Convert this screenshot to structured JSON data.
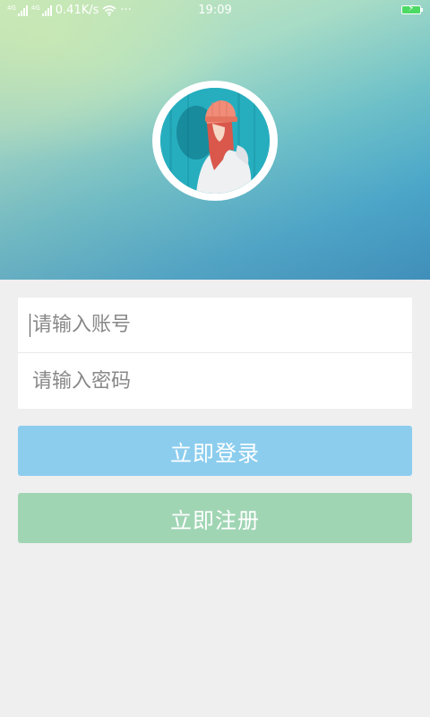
{
  "status_bar": {
    "speed": "0.41K/s",
    "more": "···",
    "time": "19:09",
    "sim1_tag": "4G",
    "sim2_tag": "4G"
  },
  "login": {
    "account_placeholder": "请输入账号",
    "password_placeholder": "请输入密码",
    "login_button": "立即登录",
    "register_button": "立即注册"
  },
  "colors": {
    "login_button": "#8ccdee",
    "register_button": "#a0d5b4",
    "background": "#efefef"
  }
}
